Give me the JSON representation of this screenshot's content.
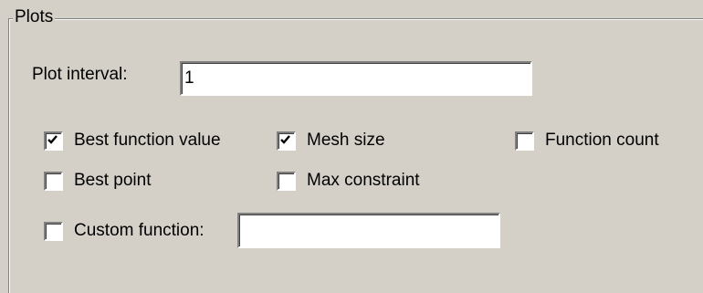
{
  "group": {
    "title": "Plots"
  },
  "plot_interval": {
    "label": "Plot interval:",
    "value": "1"
  },
  "checkboxes": [
    {
      "label": "Best function value",
      "checked": true
    },
    {
      "label": "Mesh size",
      "checked": true
    },
    {
      "label": "Function count",
      "checked": false
    },
    {
      "label": "Best point",
      "checked": false
    },
    {
      "label": "Max constraint",
      "checked": false
    },
    {
      "label": "Custom function:",
      "checked": false
    }
  ],
  "custom_function": {
    "value": ""
  },
  "icons": {
    "check": "check-mark-icon"
  }
}
